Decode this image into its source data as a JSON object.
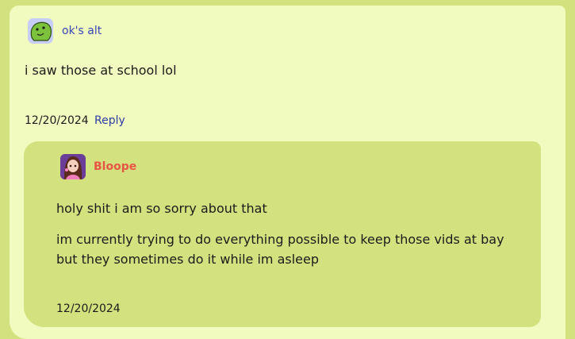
{
  "comment": {
    "author": "ok's alt",
    "text": "i saw those at school lol",
    "date": "12/20/2024",
    "reply_label": "Reply",
    "avatar_icon": "green-blob-avatar-icon"
  },
  "reply": {
    "author": "Bloope",
    "paragraphs": [
      "holy shit i am so sorry about that",
      "im currently trying to do everything possible to keep those vids at bay but they sometimes do it while im asleep"
    ],
    "date": "12/20/2024",
    "avatar_icon": "character-portrait-avatar-icon"
  },
  "colors": {
    "page_bg": "#d3e27f",
    "card_bg": "#f1fbbf",
    "link": "#2e3fa7",
    "author_highlight": "#e85545"
  }
}
